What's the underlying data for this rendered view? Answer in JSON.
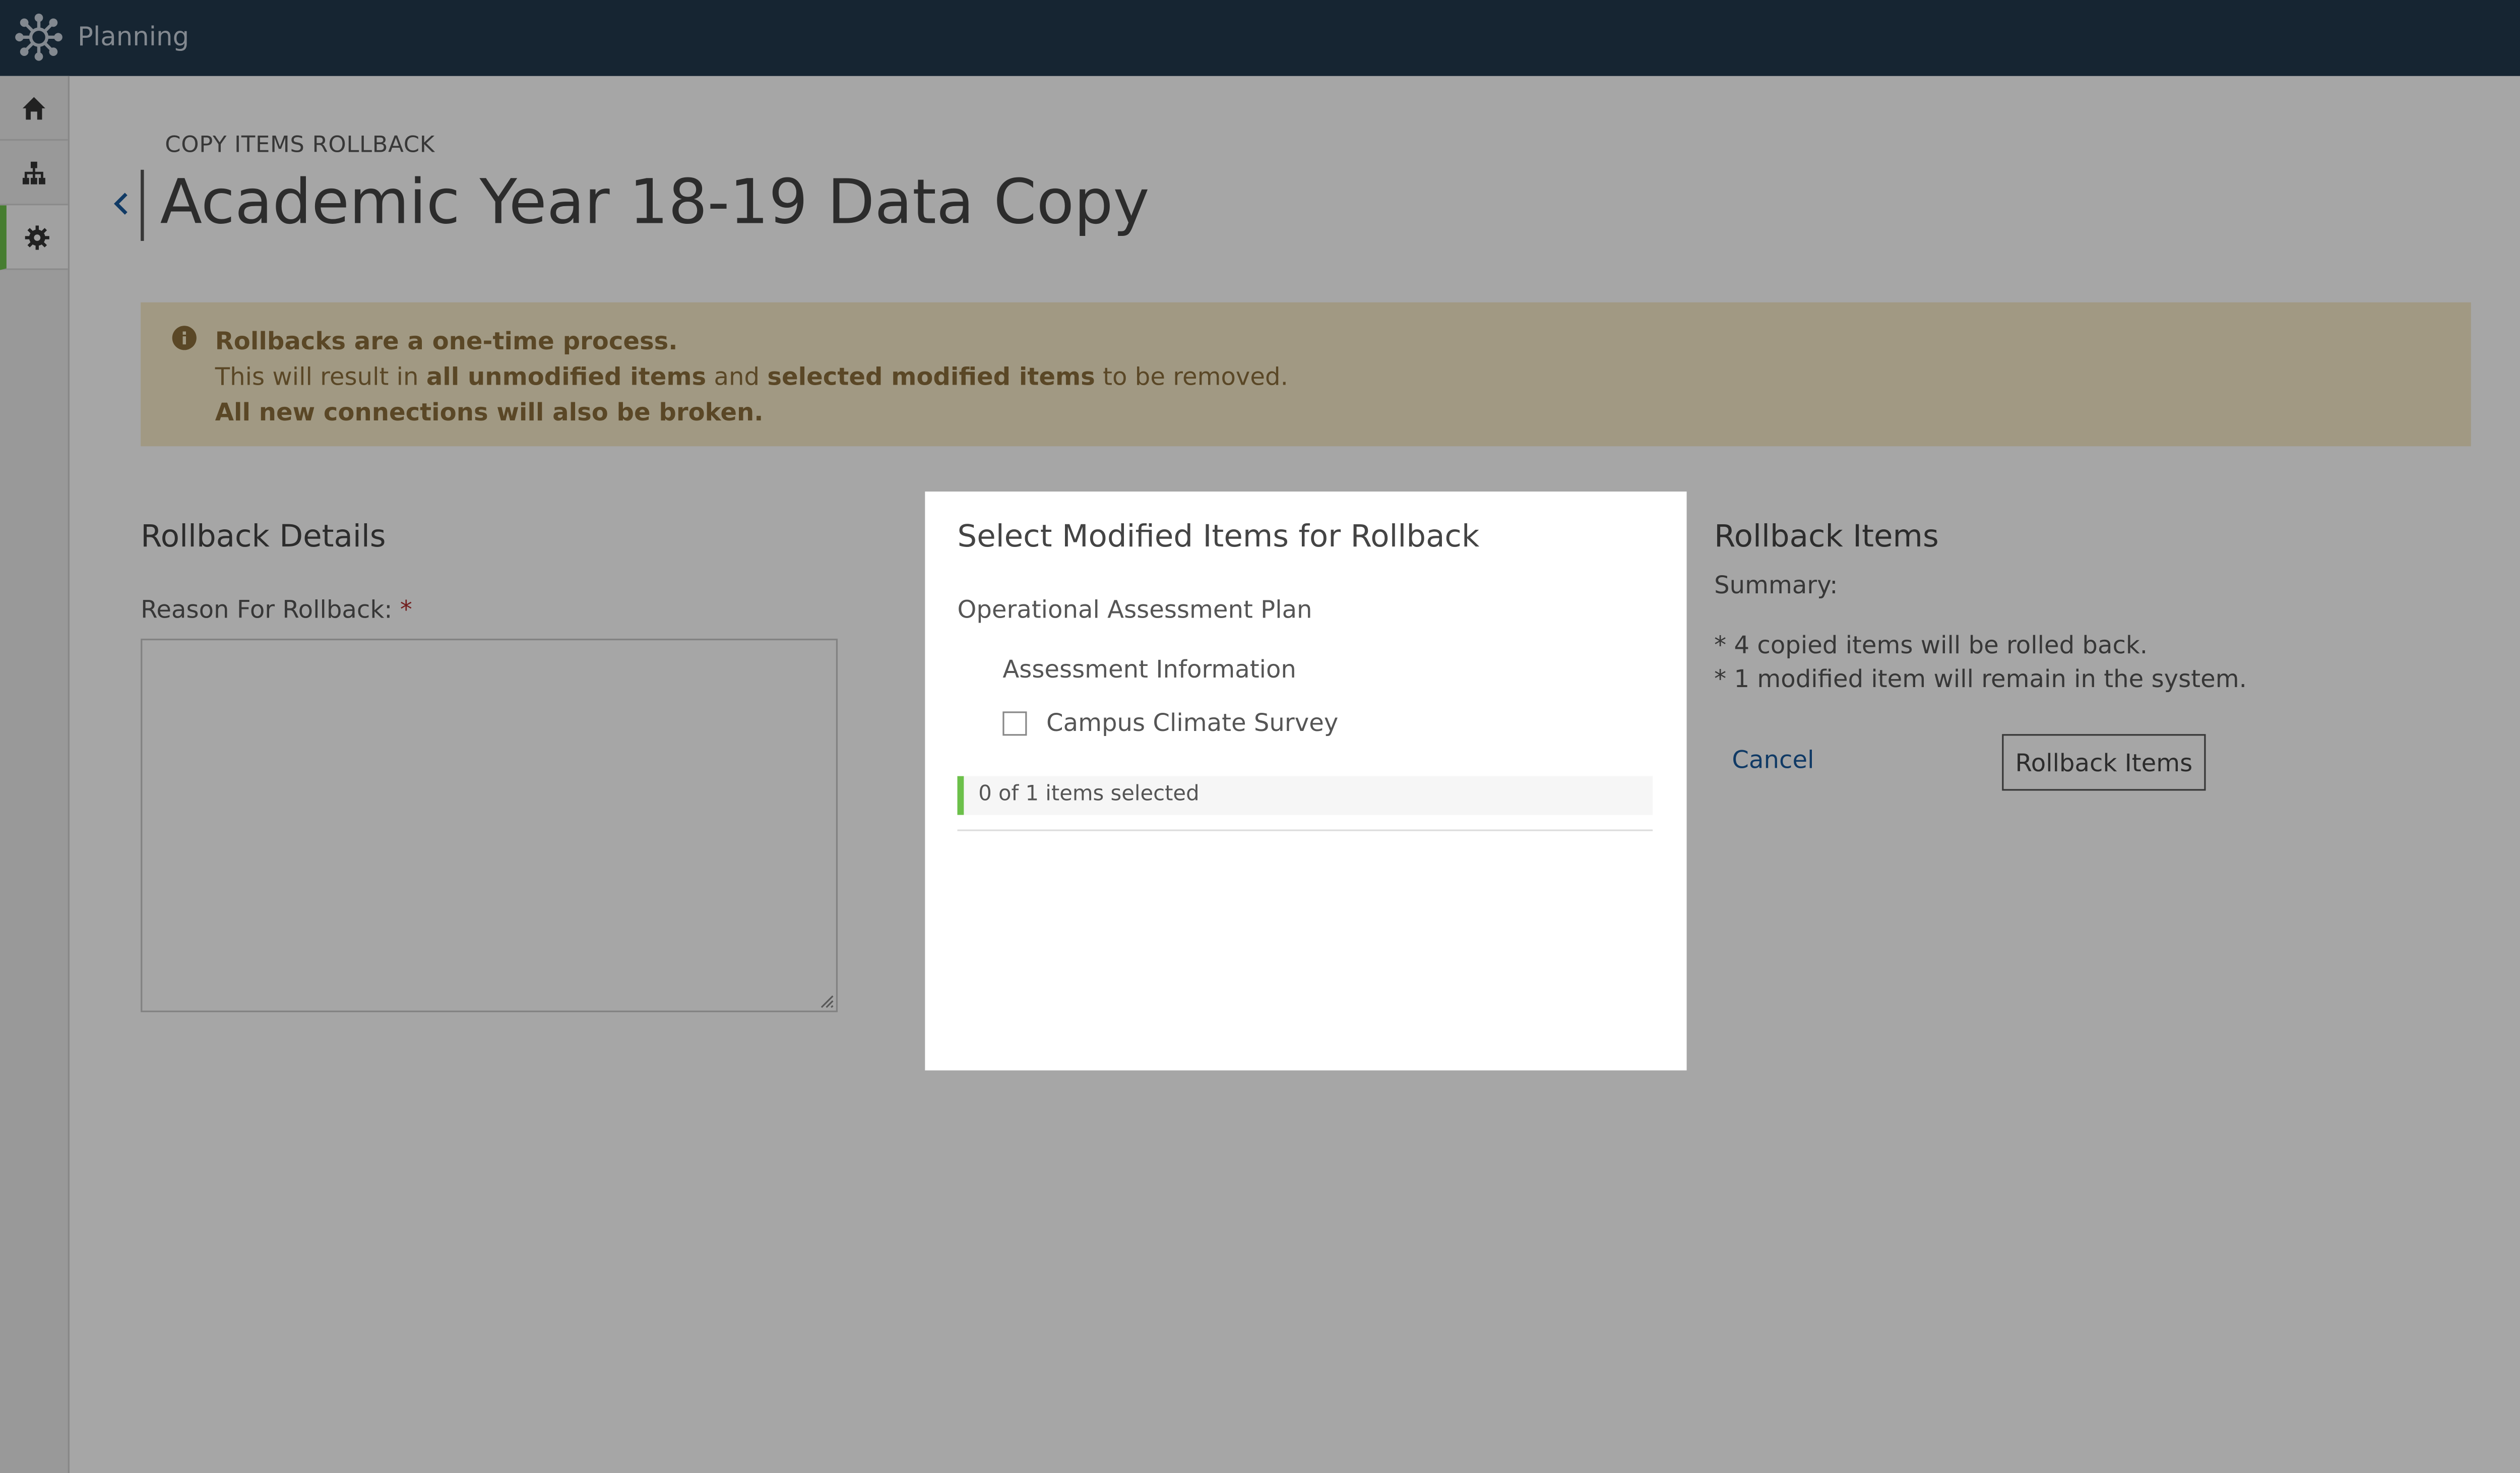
{
  "app": {
    "title": "Planning"
  },
  "sidebar": {
    "items": [
      {
        "name": "home",
        "icon": "home-icon"
      },
      {
        "name": "hierarchy",
        "icon": "org-chart-icon"
      },
      {
        "name": "settings",
        "icon": "gear-icon",
        "active": true
      }
    ]
  },
  "page": {
    "eyebrow": "COPY ITEMS ROLLBACK",
    "title": "Academic Year 18-19 Data Copy"
  },
  "alert": {
    "line1": "Rollbacks are a one-time process.",
    "line2_a": "This will result in ",
    "line2_b": "all unmodified items",
    "line2_c": " and ",
    "line2_d": "selected modified items",
    "line2_e": " to be removed.",
    "line3": "All new connections will also be broken."
  },
  "details": {
    "heading": "Rollback Details",
    "reason_label": "Reason For Rollback:",
    "required_mark": "*",
    "reason_value": ""
  },
  "items": {
    "heading": "Rollback Items",
    "summary_label": "Summary:",
    "summary_lines": [
      "* 4 copied items will be rolled back.",
      "* 1 modified item will remain in the system."
    ],
    "cancel_label": "Cancel",
    "rollback_label": "Rollback Items"
  },
  "modal": {
    "title": "Select Modified Items for Rollback",
    "plan": "Operational Assessment Plan",
    "section": "Assessment Information",
    "item_label": "Campus Climate Survey",
    "item_checked": false,
    "selected_count": "0 of 1 items selected"
  },
  "colors": {
    "topbar": "#23394d",
    "accent_green": "#6cc04a",
    "link_blue": "#1a5a9c",
    "alert_bg": "#f8ecca",
    "alert_text": "#8a6d3b"
  }
}
